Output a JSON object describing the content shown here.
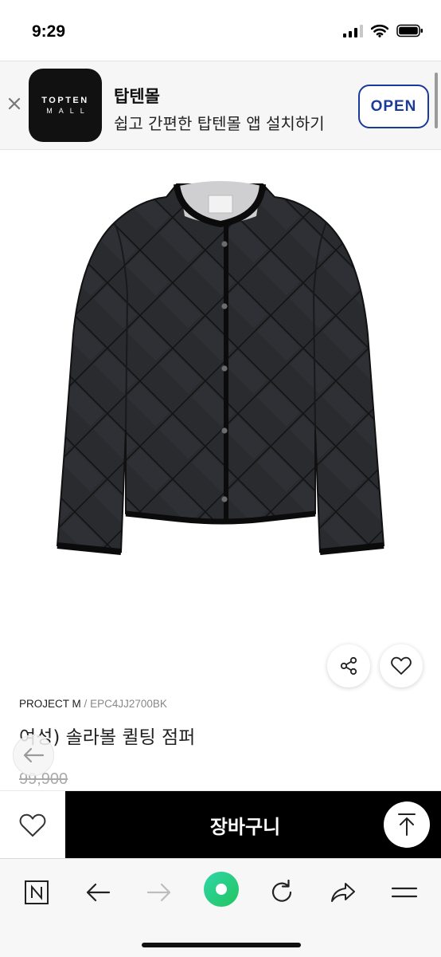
{
  "status_bar": {
    "time": "9:29"
  },
  "app_banner": {
    "logo_top": "TOPTEN",
    "logo_bottom": "MALL",
    "app_name": "탑텐몰",
    "description": "쉽고 간편한 탑텐몰 앱 설치하기",
    "open_label": "OPEN"
  },
  "product": {
    "brand": "PROJECT M",
    "separator": "/",
    "code": "EPC4JJ2700BK",
    "title": "여성) 솔라볼 퀼팅 점퍼",
    "price": "99,900"
  },
  "buy_bar": {
    "cart_label": "장바구니"
  },
  "icons": {
    "close": "close-icon",
    "share": "share-icon",
    "wish": "heart-icon",
    "back": "arrow-left-icon",
    "top": "arrow-up-to-top-icon",
    "n": "naver-n-icon",
    "forward": "arrow-right-icon",
    "home": "green-dot-icon",
    "refresh": "refresh-icon",
    "share_browser": "forward-share-icon",
    "menu": "menu-icon"
  },
  "colors": {
    "open_button": "#1b3a99",
    "cart_button": "#000000",
    "green_dot": "#2bd07f"
  }
}
